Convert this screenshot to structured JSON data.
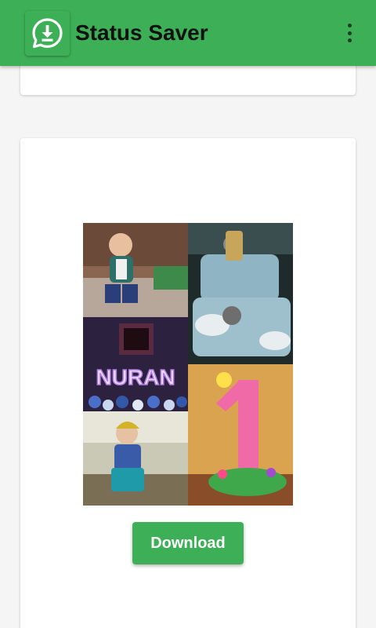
{
  "app": {
    "title": "Status Saver",
    "logo_icon": "whatsapp-download-icon",
    "menu_icon": "more-vert-icon"
  },
  "status_card": {
    "image_text": "NURAN",
    "download_label": "Download"
  },
  "colors": {
    "primary": "#3daf57",
    "title_text": "#111111",
    "background": "#f5f5f5",
    "card": "#ffffff"
  }
}
